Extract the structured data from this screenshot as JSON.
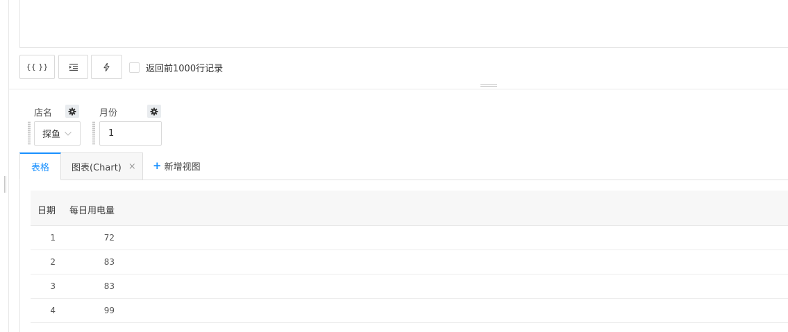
{
  "toolbar": {
    "format_label": "{{ }}",
    "indent_icon": "indent-icon",
    "run_icon": "lightning-icon",
    "limit_checkbox_label": "返回前1000行记录",
    "limit_checked": false
  },
  "params": {
    "store": {
      "label": "店名",
      "value": "探鱼",
      "icon": "gear-icon"
    },
    "month": {
      "label": "月份",
      "value": "1",
      "icon": "gear-icon"
    }
  },
  "tabs": {
    "table_label": "表格",
    "chart_label": "图表(Chart)",
    "close_glyph": "×",
    "add_label": "新增视图",
    "add_glyph": "+"
  },
  "table": {
    "columns": [
      "日期",
      "每日用电量"
    ],
    "rows": [
      [
        "1",
        "72"
      ],
      [
        "2",
        "83"
      ],
      [
        "3",
        "83"
      ],
      [
        "4",
        "99"
      ]
    ]
  },
  "colors": {
    "accent": "#1890ff",
    "border": "#d9d9d9",
    "header_bg": "#f7f7f7"
  }
}
